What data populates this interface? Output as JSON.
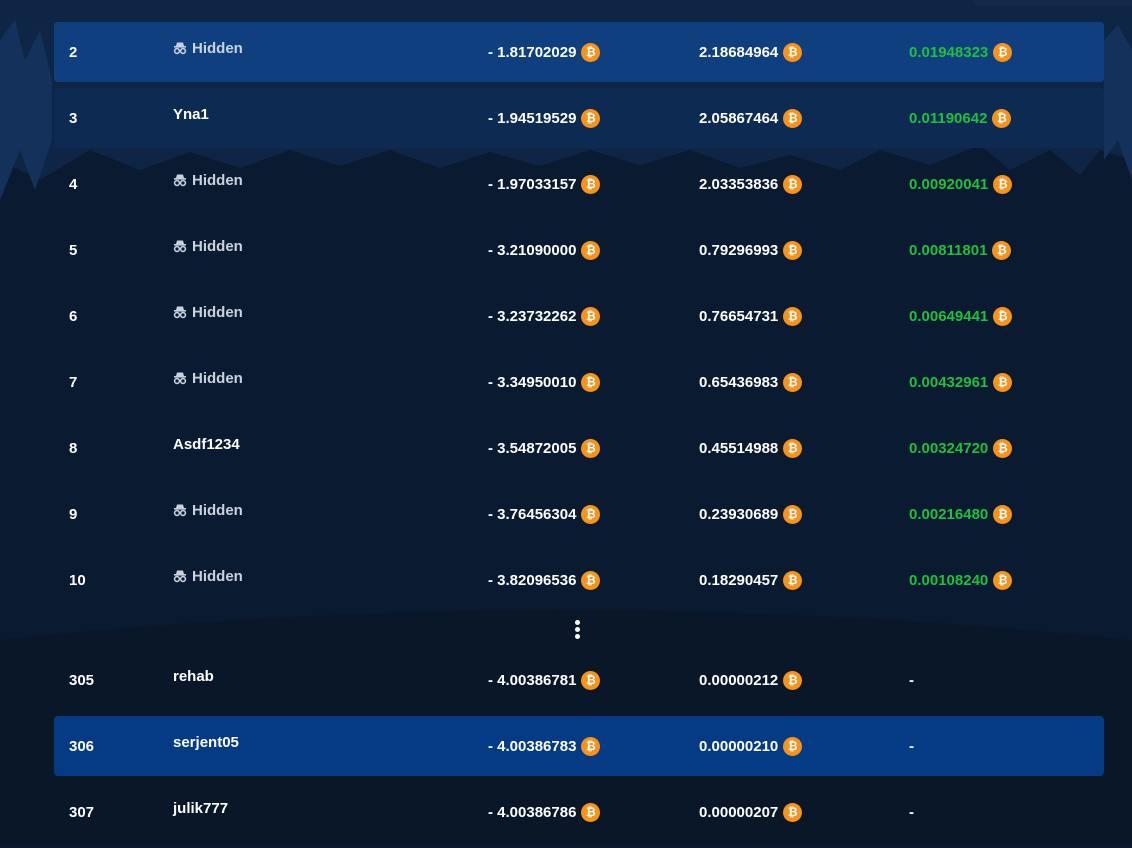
{
  "leaderboard": {
    "rows": [
      {
        "rank": "2",
        "user": "Hidden",
        "hidden": true,
        "wager": "- 1.81702029",
        "profit": "2.18684964",
        "prize": "0.01948323",
        "prize_currency": true,
        "highlight": "hl-a"
      },
      {
        "rank": "3",
        "user": "Yna1",
        "hidden": false,
        "wager": "- 1.94519529",
        "profit": "2.05867464",
        "prize": "0.01190642",
        "prize_currency": true,
        "highlight": "hl-b"
      },
      {
        "rank": "4",
        "user": "Hidden",
        "hidden": true,
        "wager": "- 1.97033157",
        "profit": "2.03353836",
        "prize": "0.00920041",
        "prize_currency": true,
        "highlight": ""
      },
      {
        "rank": "5",
        "user": "Hidden",
        "hidden": true,
        "wager": "- 3.21090000",
        "profit": "0.79296993",
        "prize": "0.00811801",
        "prize_currency": true,
        "highlight": ""
      },
      {
        "rank": "6",
        "user": "Hidden",
        "hidden": true,
        "wager": "- 3.23732262",
        "profit": "0.76654731",
        "prize": "0.00649441",
        "prize_currency": true,
        "highlight": ""
      },
      {
        "rank": "7",
        "user": "Hidden",
        "hidden": true,
        "wager": "- 3.34950010",
        "profit": "0.65436983",
        "prize": "0.00432961",
        "prize_currency": true,
        "highlight": ""
      },
      {
        "rank": "8",
        "user": "Asdf1234",
        "hidden": false,
        "wager": "- 3.54872005",
        "profit": "0.45514988",
        "prize": "0.00324720",
        "prize_currency": true,
        "highlight": ""
      },
      {
        "rank": "9",
        "user": "Hidden",
        "hidden": true,
        "wager": "- 3.76456304",
        "profit": "0.23930689",
        "prize": "0.00216480",
        "prize_currency": true,
        "highlight": ""
      },
      {
        "rank": "10",
        "user": "Hidden",
        "hidden": true,
        "wager": "- 3.82096536",
        "profit": "0.18290457",
        "prize": "0.00108240",
        "prize_currency": true,
        "highlight": ""
      }
    ],
    "bottom_rows": [
      {
        "rank": "305",
        "user": "rehab",
        "hidden": false,
        "wager": "- 4.00386781",
        "profit": "0.00000212",
        "prize": "-",
        "prize_currency": false,
        "highlight": ""
      },
      {
        "rank": "306",
        "user": "serjent05",
        "hidden": false,
        "wager": "- 4.00386783",
        "profit": "0.00000210",
        "prize": "-",
        "prize_currency": false,
        "highlight": "hl-c"
      },
      {
        "rank": "307",
        "user": "julik777",
        "hidden": false,
        "wager": "- 4.00386786",
        "profit": "0.00000207",
        "prize": "-",
        "prize_currency": false,
        "highlight": ""
      }
    ]
  },
  "currency_symbol": "₿",
  "icons": {
    "hidden_user": "incognito-icon",
    "currency": "bitcoin-icon",
    "more": "vertical-ellipsis-icon"
  },
  "colors": {
    "background": "#0a1a31",
    "highlight_primary": "#0f3f7e",
    "highlight_secondary": "#0c2a52",
    "current_user": "#053b84",
    "prize_green": "#1ec03c",
    "bitcoin_orange": "#f7931a"
  }
}
